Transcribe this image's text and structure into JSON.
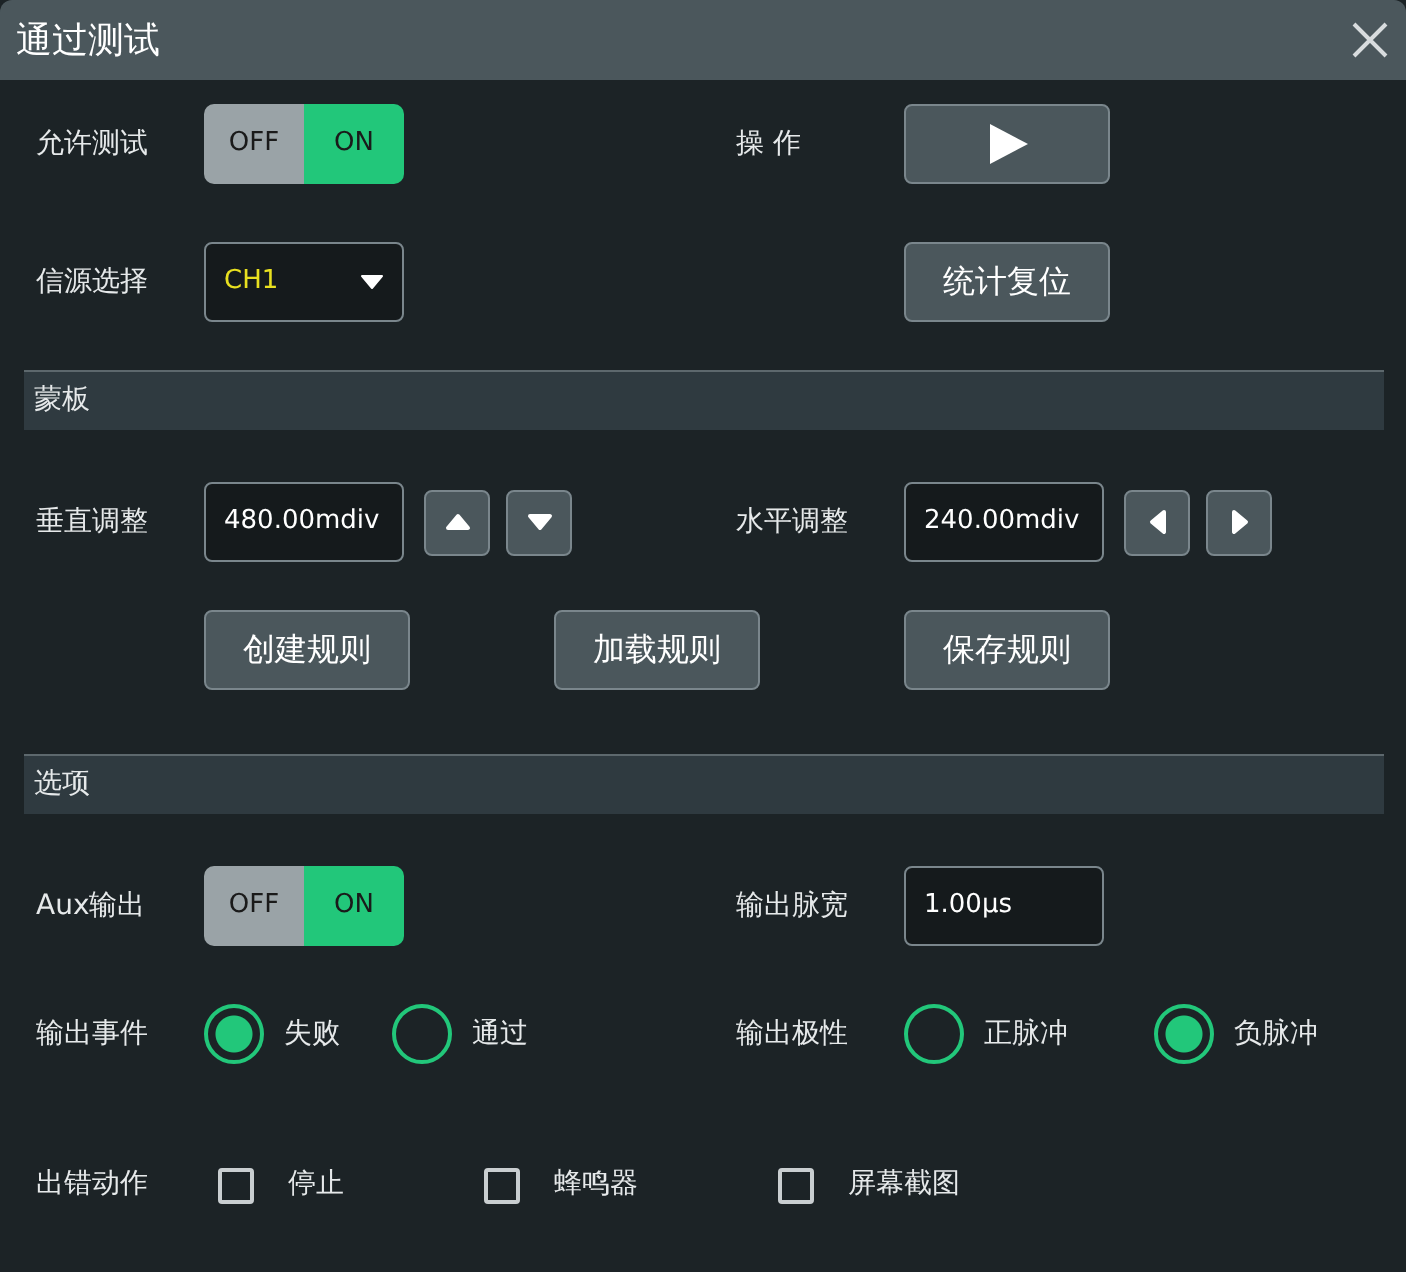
{
  "title": "通过测试",
  "general": {
    "enable_test": {
      "label": "允许测试",
      "off_label": "OFF",
      "on_label": "ON",
      "on": true
    },
    "operation": {
      "label": "操 作"
    },
    "source": {
      "label": "信源选择",
      "value": "CH1"
    },
    "reset_button": "统计复位"
  },
  "mask": {
    "heading": "蒙板",
    "vertical": {
      "label": "垂直调整",
      "value": "480.00mdiv"
    },
    "horizontal": {
      "label": "水平调整",
      "value": "240.00mdiv"
    },
    "buttons": [
      "创建规则",
      "加载规则",
      "保存规则"
    ]
  },
  "options": {
    "heading": "选项",
    "aux_output": {
      "label": "Aux输出",
      "off_label": "OFF",
      "on_label": "ON",
      "on": true
    },
    "pulse_width": {
      "label": "输出脉宽",
      "value": "1.00μs"
    },
    "output_event": {
      "label": "输出事件",
      "choices": [
        {
          "label": "失败",
          "selected": true
        },
        {
          "label": "通过",
          "selected": false
        }
      ]
    },
    "polarity": {
      "label": "输出极性",
      "choices": [
        {
          "label": "正脉冲",
          "selected": false
        },
        {
          "label": "负脉冲",
          "selected": true
        }
      ]
    },
    "error_actions": {
      "label": "出错动作",
      "items": [
        {
          "label": "停止",
          "checked": false
        },
        {
          "label": "蜂鸣器",
          "checked": false
        },
        {
          "label": "屏幕截图",
          "checked": false
        }
      ]
    }
  }
}
